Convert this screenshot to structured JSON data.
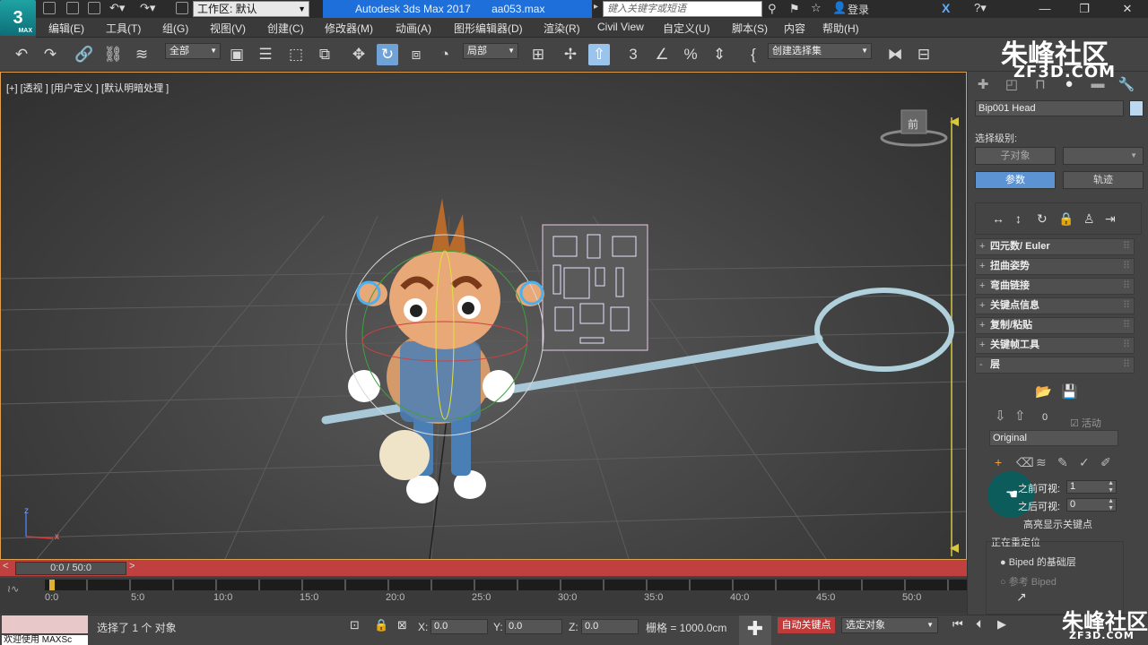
{
  "title_bar": {
    "workspace": "工作区: 默认",
    "app_name": "Autodesk 3ds Max 2017",
    "file_name": "aa053.max",
    "search_placeholder": "键入关键字或短语",
    "login": "登录"
  },
  "menu": [
    "编辑(E)",
    "工具(T)",
    "组(G)",
    "视图(V)",
    "创建(C)",
    "修改器(M)",
    "动画(A)",
    "图形编辑器(D)",
    "渲染(R)",
    "Civil View",
    "自定义(U)",
    "脚本(S)",
    "内容",
    "帮助(H)"
  ],
  "toolbar": {
    "filter_dropdown": "全部",
    "coord_dropdown": "局部",
    "selection_set": "创建选择集"
  },
  "viewport": {
    "label": "[+] [透视 ] [用户定义 ] [默认明暗处理 ]",
    "viewcube_label": "前",
    "axis_x": "x",
    "axis_z": "z"
  },
  "command_panel": {
    "object_name": "Bip001 Head",
    "selection_level_label": "选择级别:",
    "sub_object_btn": "子对象",
    "params_btn": "参数",
    "trajectory_btn": "轨迹",
    "rollouts": [
      "四元数/ Euler",
      "扭曲姿势",
      "弯曲链接",
      "关键点信息",
      "复制/粘贴",
      "关键帧工具",
      "层"
    ],
    "layer_count": "0",
    "active_label": "活动",
    "layer_name": "Original",
    "before_visible_label": "之前可视:",
    "before_visible_value": "1",
    "after_visible_label": "之后可视:",
    "after_visible_value": "0",
    "highlight_keys_label": "高亮显示关键点",
    "retarget_label": "正在重定位",
    "biped_base_layer": "Biped 的基础层",
    "reference_biped": "参考 Biped"
  },
  "timeline": {
    "slider_label": "0:0 / 50:0",
    "ticks": [
      "0:0",
      "5:0",
      "10:0",
      "15:0",
      "20:0",
      "25:0",
      "30:0",
      "35:0",
      "40:0",
      "45:0",
      "50:0"
    ]
  },
  "status": {
    "maxscript_welcome": "欢迎使用 MAXSc",
    "selected_msg": "选择了 1 个 对象",
    "x_label": "X:",
    "x_value": "0.0",
    "y_label": "Y:",
    "y_value": "0.0",
    "z_label": "Z:",
    "z_value": "0.0",
    "grid_label": "栅格 = 1000.0cm",
    "auto_key": "自动关键点",
    "selected_obj": "选定对象"
  },
  "watermark": {
    "brand": "朱峰社区",
    "site": "ZF3D.COM"
  },
  "colors": {
    "title_blue": "#1e6fd9",
    "active_tool": "#6fa3d8",
    "timeline_red": "#c04040",
    "viewport_border": "#e0a050",
    "params_on": "#5b93d3"
  }
}
